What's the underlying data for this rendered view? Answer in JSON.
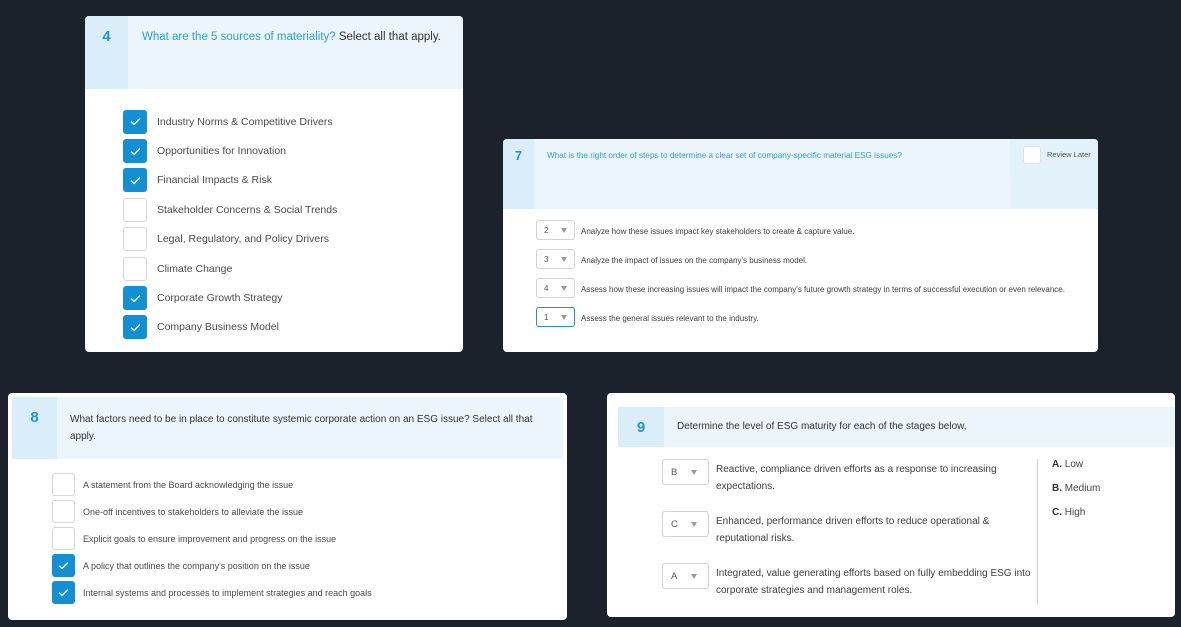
{
  "q4": {
    "number": "4",
    "question_link": "What are the 5 sources of materiality?",
    "question_suffix": " Select all that apply.",
    "options": [
      {
        "label": "Industry Norms & Competitive Drivers",
        "checked": true
      },
      {
        "label": "Opportunities for Innovation",
        "checked": true
      },
      {
        "label": "Financial Impacts & Risk",
        "checked": true
      },
      {
        "label": "Stakeholder Concerns & Social Trends",
        "checked": false
      },
      {
        "label": "Legal, Regulatory, and Policy Drivers",
        "checked": false
      },
      {
        "label": "Climate Change",
        "checked": false
      },
      {
        "label": "Corporate Growth Strategy",
        "checked": true
      },
      {
        "label": "Company Business Model",
        "checked": true
      }
    ]
  },
  "q7": {
    "number": "7",
    "question": "What is the right order of steps to determine a clear set of company-specific material ESG issues?",
    "review_later": "Review Later",
    "steps": [
      {
        "value": "2",
        "text": "Analyze how these issues impact key stakeholders to create & capture value."
      },
      {
        "value": "3",
        "text": "Analyze the impact of issues on the company's business model."
      },
      {
        "value": "4",
        "text": "Assess how these increasing issues will impact the company's future growth strategy in terms of successful execution or even relevance."
      },
      {
        "value": "1",
        "text": "Assess the general issues relevant to the industry."
      }
    ]
  },
  "q8": {
    "number": "8",
    "question": "What factors need to be in place to constitute systemic corporate action on an ESG issue? Select all that apply.",
    "options": [
      {
        "label": "A statement from the Board acknowledging the issue",
        "checked": false
      },
      {
        "label": "One-off incentives to stakeholders to alleviate the issue",
        "checked": false
      },
      {
        "label": "Explicit goals to ensure improvement and progress on the issue",
        "checked": false
      },
      {
        "label": "A policy that outlines the company's position on the issue",
        "checked": true
      },
      {
        "label": "Internal systems and processes to implement strategies and reach goals",
        "checked": true
      }
    ]
  },
  "q9": {
    "number": "9",
    "question": "Determine the level of ESG maturity for each of the stages below,",
    "items": [
      {
        "value": "B",
        "text": "Reactive, compliance driven efforts as a response to increasing expectations."
      },
      {
        "value": "C",
        "text": "Enhanced, performance driven efforts to reduce operational & reputational risks."
      },
      {
        "value": "A",
        "text": "Integrated, value generating efforts based on fully embedding ESG into corporate strategies and management roles."
      }
    ],
    "legend": [
      {
        "key": "A.",
        "label": " Low"
      },
      {
        "key": "B.",
        "label": " Medium"
      },
      {
        "key": "C.",
        "label": " High"
      }
    ]
  },
  "colors": {
    "accent": "#158fd4",
    "header_bg": "#ecf5fb",
    "number_bg": "#daeef9",
    "page_bg": "#1b222b"
  }
}
